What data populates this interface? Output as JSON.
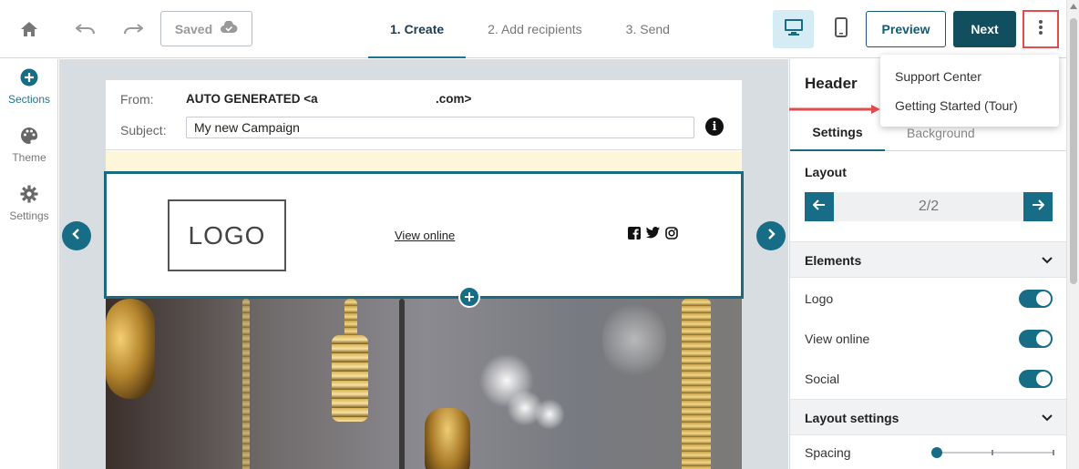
{
  "topbar": {
    "saved_label": "Saved",
    "steps": [
      {
        "label": "1. Create",
        "active": true
      },
      {
        "label": "2. Add recipients",
        "active": false
      },
      {
        "label": "3. Send",
        "active": false
      }
    ],
    "preview_label": "Preview",
    "next_label": "Next",
    "icons": [
      "home-icon",
      "undo-icon",
      "redo-icon",
      "cloud-check-icon",
      "desktop-icon",
      "mobile-icon",
      "more-vertical-icon"
    ]
  },
  "menu": {
    "items": [
      "Support Center",
      "Getting Started (Tour)"
    ]
  },
  "leftrail": {
    "items": [
      {
        "label": "Sections",
        "icon": "plus-circle-icon",
        "active": true
      },
      {
        "label": "Theme",
        "icon": "palette-icon",
        "active": false
      },
      {
        "label": "Settings",
        "icon": "gear-icon",
        "active": false
      }
    ]
  },
  "email": {
    "from_label": "From:",
    "from_value_start": "AUTO GENERATED <a",
    "from_value_end": ".com>",
    "subject_label": "Subject:",
    "subject_value": "My new Campaign",
    "info_glyph": "i",
    "header": {
      "logo_text": "LOGO",
      "view_online": "View online",
      "social": [
        "facebook-icon",
        "twitter-icon",
        "instagram-icon"
      ]
    }
  },
  "panel": {
    "title": "Header",
    "tabs": [
      {
        "label": "Settings",
        "active": true
      },
      {
        "label": "Background",
        "active": false
      }
    ],
    "layout_label": "Layout",
    "layout_value": "2/2",
    "elements_label": "Elements",
    "toggles": [
      {
        "label": "Logo",
        "on": true
      },
      {
        "label": "View online",
        "on": true
      },
      {
        "label": "Social",
        "on": true
      }
    ],
    "layout_settings_label": "Layout settings",
    "spacing_label": "Spacing",
    "spacing_value": 0
  },
  "colors": {
    "accent": "#176d85",
    "primary_button": "#114f5e",
    "highlight": "#e24c4c",
    "preheader": "#fdf6da"
  }
}
